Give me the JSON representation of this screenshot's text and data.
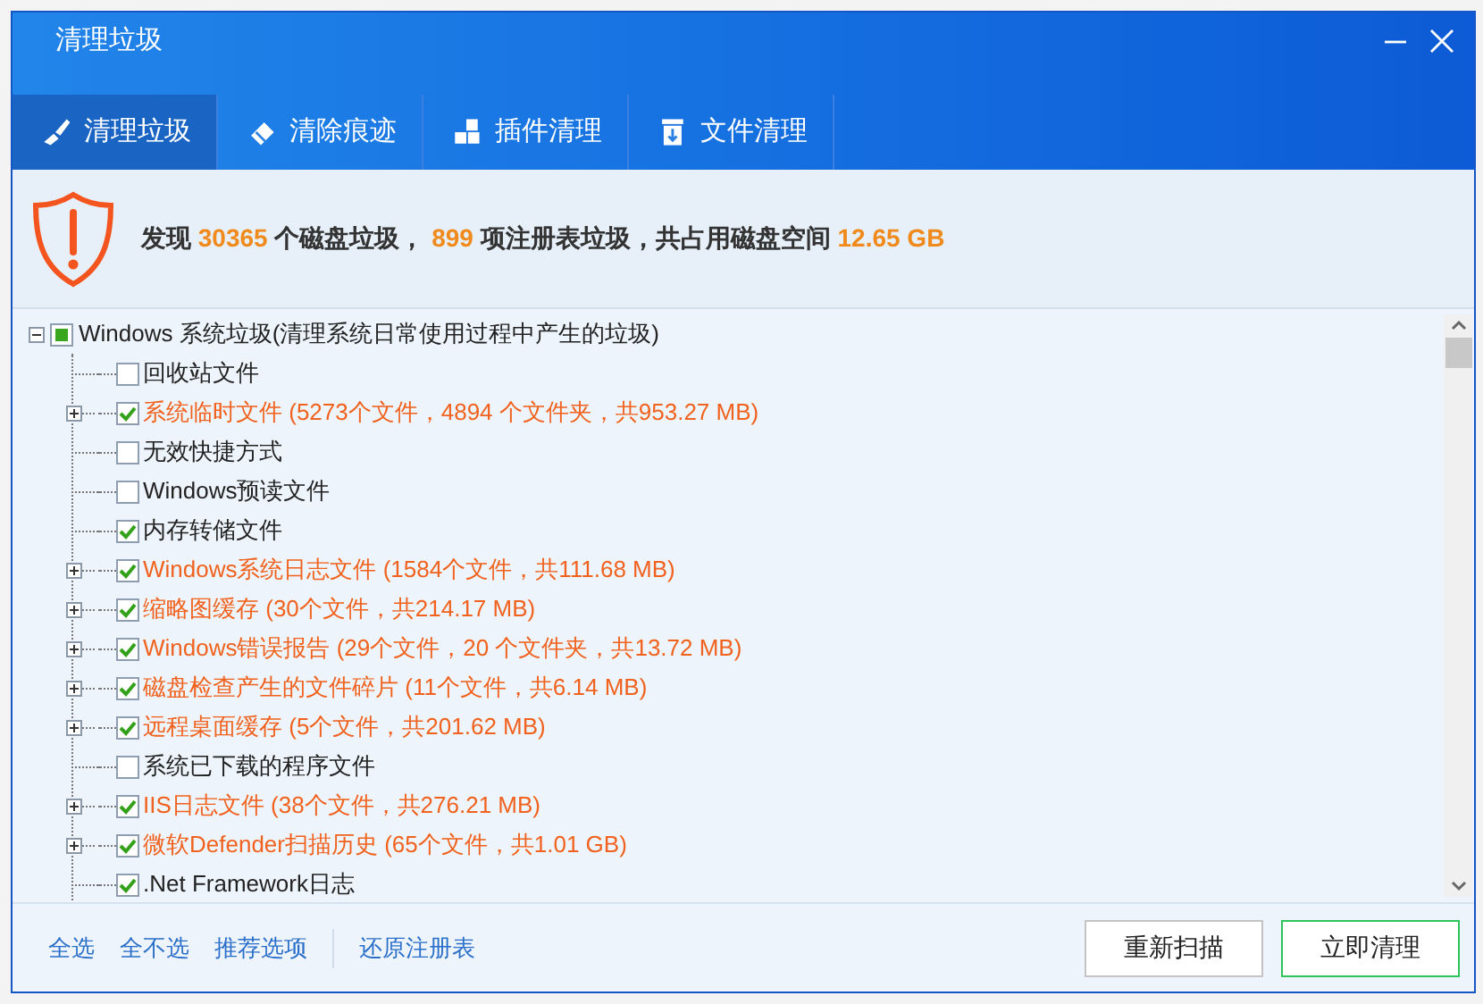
{
  "window": {
    "title": "清理垃圾"
  },
  "tabs": [
    {
      "label": "清理垃圾",
      "selected": true
    },
    {
      "label": "清除痕迹",
      "selected": false
    },
    {
      "label": "插件清理",
      "selected": false
    },
    {
      "label": "文件清理",
      "selected": false
    }
  ],
  "summary": {
    "prefix": "发现",
    "disk_count": "30365",
    "mid": "个磁盘垃圾，",
    "registry_count": "899",
    "mid2": "项注册表垃圾，共占用磁盘空间",
    "size": "12.65 GB"
  },
  "tree": {
    "label": "Windows 系统垃圾(清理系统日常使用过程中产生的垃圾)",
    "expanded": true,
    "checked": true,
    "partial": true,
    "children": [
      {
        "label": "回收站文件",
        "checked": false,
        "expandable": false,
        "found": false
      },
      {
        "label": "系统临时文件 (5273个文件，4894 个文件夹，共953.27 MB)",
        "checked": true,
        "expandable": true,
        "found": true
      },
      {
        "label": "无效快捷方式",
        "checked": false,
        "expandable": false,
        "found": false
      },
      {
        "label": "Windows预读文件",
        "checked": false,
        "expandable": false,
        "found": false
      },
      {
        "label": "内存转储文件",
        "checked": true,
        "expandable": false,
        "found": false
      },
      {
        "label": "Windows系统日志文件 (1584个文件，共111.68 MB)",
        "checked": true,
        "expandable": true,
        "found": true
      },
      {
        "label": "缩略图缓存 (30个文件，共214.17 MB)",
        "checked": true,
        "expandable": true,
        "found": true
      },
      {
        "label": "Windows错误报告 (29个文件，20 个文件夹，共13.72 MB)",
        "checked": true,
        "expandable": true,
        "found": true
      },
      {
        "label": "磁盘检查产生的文件碎片 (11个文件，共6.14 MB)",
        "checked": true,
        "expandable": true,
        "found": true
      },
      {
        "label": "远程桌面缓存 (5个文件，共201.62 MB)",
        "checked": true,
        "expandable": true,
        "found": true
      },
      {
        "label": "系统已下载的程序文件",
        "checked": false,
        "expandable": false,
        "found": false
      },
      {
        "label": "IIS日志文件 (38个文件，共276.21 MB)",
        "checked": true,
        "expandable": true,
        "found": true
      },
      {
        "label": "微软Defender扫描历史 (65个文件，共1.01 GB)",
        "checked": true,
        "expandable": true,
        "found": true
      },
      {
        "label": ".Net Framework日志",
        "checked": true,
        "expandable": false,
        "found": false
      }
    ]
  },
  "footer": {
    "links": [
      "全选",
      "全不选",
      "推荐选项"
    ],
    "restore_link": "还原注册表",
    "buttons": [
      {
        "label": "重新扫描",
        "primary": false
      },
      {
        "label": "立即清理",
        "primary": true
      }
    ]
  }
}
